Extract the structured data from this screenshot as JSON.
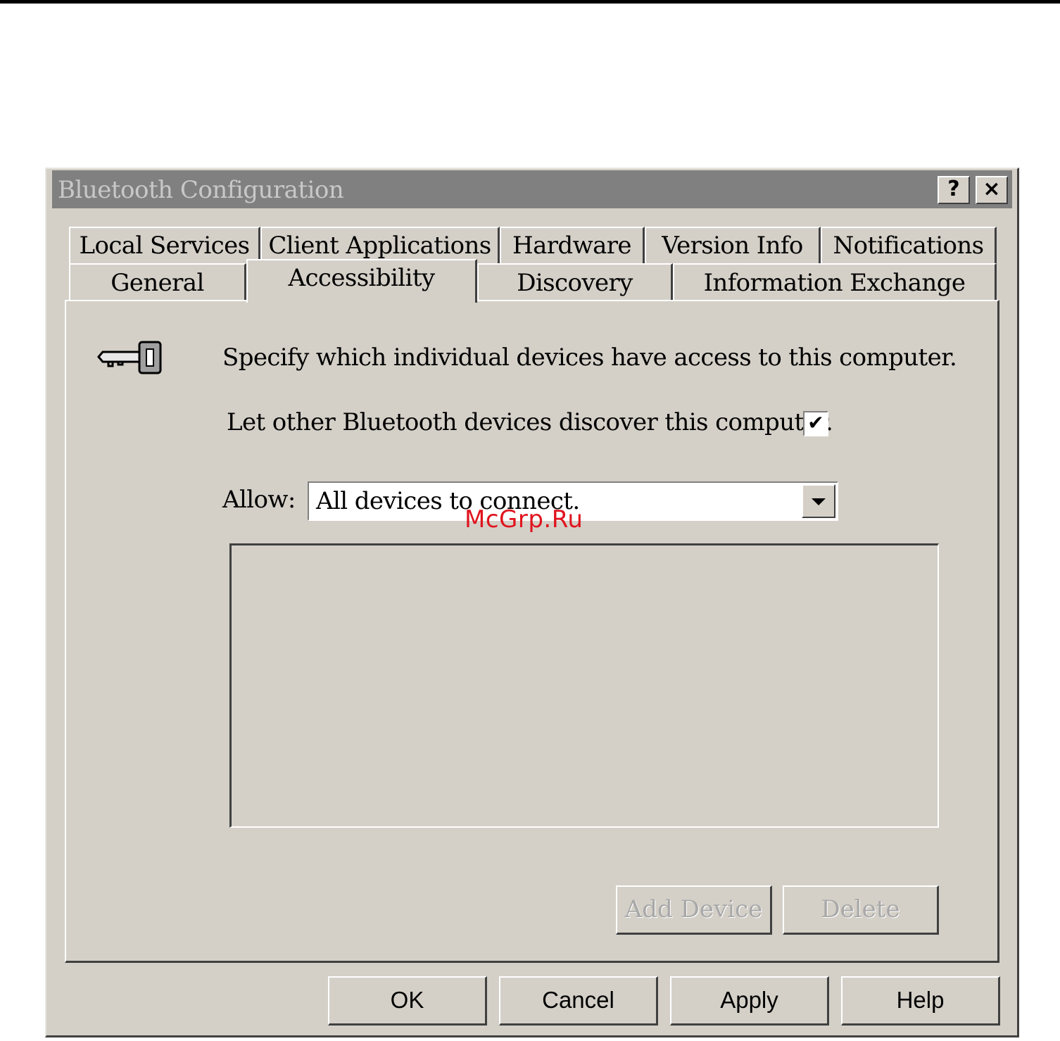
{
  "window": {
    "title": "Bluetooth Configuration",
    "help_btn": "?",
    "close_btn": "×"
  },
  "tabs": {
    "row1": [
      "Local Services",
      "Client Applications",
      "Hardware",
      "Version Info",
      "Notifications"
    ],
    "row2": [
      "General",
      "Accessibility",
      "Discovery",
      "Information Exchange"
    ],
    "active": "Accessibility"
  },
  "panel": {
    "icon": "key-icon",
    "description": "Specify which individual devices have access to this computer.",
    "discover_label": "Let other Bluetooth devices discover this computer.",
    "discover_checked": true,
    "check_mark": "✔",
    "allow_label": "Allow:",
    "allow_value": "All devices to connect.",
    "add_device": "Add Device",
    "delete": "Delete"
  },
  "footer": {
    "ok": "OK",
    "cancel": "Cancel",
    "apply": "Apply",
    "help": "Help"
  },
  "watermark": "McGrp.Ru"
}
